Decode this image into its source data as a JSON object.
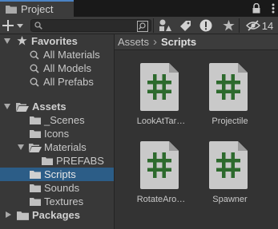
{
  "window": {
    "tab_title": "Project",
    "hidden_count": "14"
  },
  "search": {
    "placeholder": "",
    "value": ""
  },
  "tree": {
    "favorites": {
      "label": "Favorites",
      "items": [
        "All Materials",
        "All Models",
        "All Prefabs"
      ]
    },
    "assets": {
      "label": "Assets",
      "children": [
        {
          "label": "_Scenes"
        },
        {
          "label": "Icons"
        },
        {
          "label": "Materials"
        },
        {
          "label": "PREFABS"
        },
        {
          "label": "Scripts"
        },
        {
          "label": "Sounds"
        },
        {
          "label": "Textures"
        }
      ]
    },
    "packages": {
      "label": "Packages"
    }
  },
  "breadcrumb": {
    "root": "Assets",
    "separator": "›",
    "current": "Scripts"
  },
  "assets": [
    {
      "label": "LookAtTar…",
      "icon": "csharp-script-icon"
    },
    {
      "label": "Projectile",
      "icon": "csharp-script-icon"
    },
    {
      "label": "RotateAro…",
      "icon": "csharp-script-icon"
    },
    {
      "label": "Spawner",
      "icon": "csharp-script-icon"
    }
  ],
  "colors": {
    "selection": "#2c5d87",
    "tab_accent": "#4b83c4",
    "script_hash": "#2d6a2d",
    "script_page": "#c9c9c9"
  }
}
